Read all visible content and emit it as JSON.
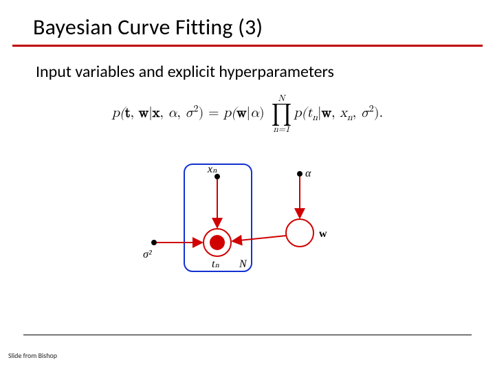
{
  "title": "Bayesian Curve Fitting (3)",
  "subtitle": "Input variables and explicit hyperparameters",
  "equation": {
    "lhs_ptw": "p(",
    "bold_t": "t",
    "comma1": ", ",
    "bold_w": "w",
    "given": "|",
    "bold_x": "x",
    "comma2": ", ",
    "alpha": "α",
    "comma3": ", ",
    "sigma": "σ",
    "sq": "2",
    "close_eq": ") = ",
    "p2": "p(",
    "bold_w2": "w",
    "given2": "|",
    "alpha2": "α",
    "close2": ") ",
    "prod_top": "N",
    "prod_sym": "∏",
    "prod_bot": "n=1",
    "p3": "p(",
    "tn_t": "t",
    "tn_n": "n",
    "given3": "|",
    "bold_w3": "w",
    "comma4": ", ",
    "xn_x": "x",
    "xn_n": "n",
    "comma5": ", ",
    "sigma3": "σ",
    "sq3": "2",
    "close3": ").",
    "period": ""
  },
  "labels": {
    "xn": "xₙ",
    "alpha": "α",
    "w": "w",
    "sigma2": "σ²",
    "tn": "tₙ",
    "N": "N"
  },
  "attribution": "Slide from Bishop"
}
